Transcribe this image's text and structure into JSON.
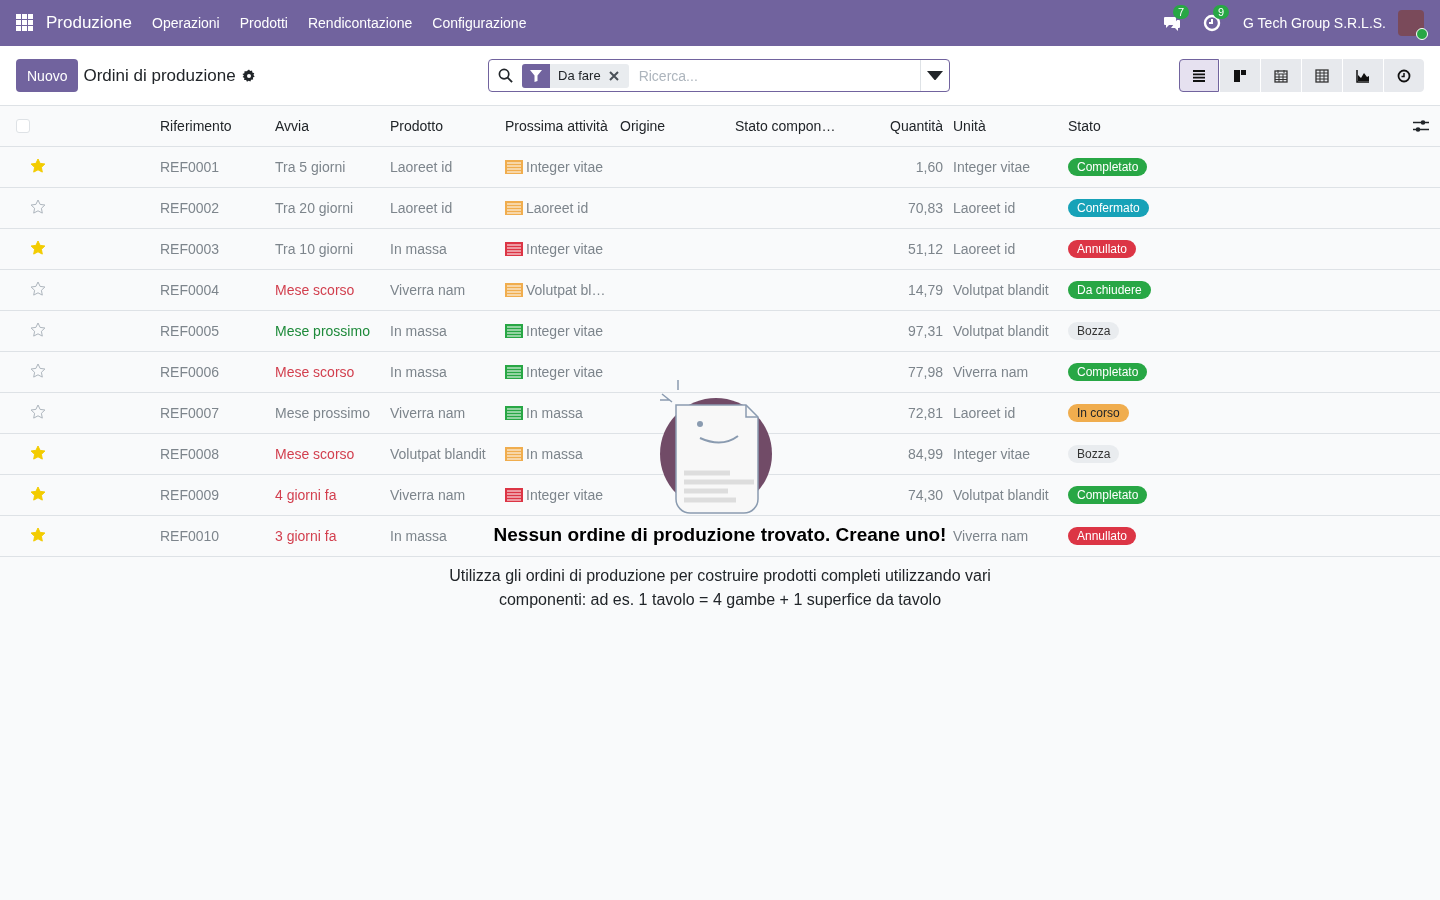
{
  "navbar": {
    "app_name": "Produzione",
    "menu": [
      "Operazioni",
      "Prodotti",
      "Rendicontazione",
      "Configurazione"
    ],
    "messages_count": "7",
    "activities_count": "9",
    "company": "G Tech Group S.R.L.S."
  },
  "control_panel": {
    "new_button": "Nuovo",
    "title": "Ordini di produzione",
    "search": {
      "facet": "Da fare",
      "placeholder": "Ricerca..."
    },
    "views": [
      {
        "kind": "list",
        "selected": true
      },
      {
        "kind": "kanban",
        "selected": false
      },
      {
        "kind": "calendar",
        "selected": false
      },
      {
        "kind": "pivot",
        "selected": false
      },
      {
        "kind": "graph",
        "selected": false
      },
      {
        "kind": "activity",
        "selected": false
      }
    ]
  },
  "table": {
    "select_all_checked": false,
    "columns": [
      "Riferimento",
      "Avvia",
      "Prodotto",
      "Prossima attività",
      "Origine",
      "Stato compon…",
      "Quantità",
      "Unità",
      "Stato"
    ],
    "rows": [
      {
        "starred": true,
        "reference": "REF0001",
        "start": {
          "label": "Tra 5 giorni",
          "color": "#7d858c"
        },
        "product": "Laoreet id",
        "activity": {
          "label": "Integer vitae",
          "color": "#f0ad4e"
        },
        "quantity": "1,60",
        "unit": "Integer vitae",
        "status": {
          "label": "Completato",
          "color": "#28a745"
        }
      },
      {
        "starred": false,
        "reference": "REF0002",
        "start": {
          "label": "Tra 20 giorni",
          "color": "#7d858c"
        },
        "product": "Laoreet id",
        "activity": {
          "label": "Laoreet id",
          "color": "#f0ad4e"
        },
        "quantity": "70,83",
        "unit": "Laoreet id",
        "status": {
          "label": "Confermato",
          "color": "#17a2b8"
        }
      },
      {
        "starred": true,
        "reference": "REF0003",
        "start": {
          "label": "Tra 10 giorni",
          "color": "#7d858c"
        },
        "product": "In massa",
        "activity": {
          "label": "Integer vitae",
          "color": "#dc3545"
        },
        "quantity": "51,12",
        "unit": "Laoreet id",
        "status": {
          "label": "Annullato",
          "color": "#dc3545"
        }
      },
      {
        "starred": false,
        "reference": "REF0004",
        "start": {
          "label": "Mese scorso",
          "color": "#d23f4e"
        },
        "product": "Viverra nam",
        "activity": {
          "label": "Volutpat bl…",
          "color": "#f0ad4e"
        },
        "quantity": "14,79",
        "unit": "Volutpat blandit",
        "status": {
          "label": "Da chiudere",
          "color": "#28a745"
        }
      },
      {
        "starred": false,
        "reference": "REF0005",
        "start": {
          "label": "Mese prossimo",
          "color": "#1e8a3a"
        },
        "product": "In massa",
        "activity": {
          "label": "Integer vitae",
          "color": "#28a745"
        },
        "quantity": "97,31",
        "unit": "Volutpat blandit",
        "status": {
          "label": "Bozza",
          "color": "#e9ecef"
        }
      },
      {
        "starred": false,
        "reference": "REF0006",
        "start": {
          "label": "Mese scorso",
          "color": "#d23f4e"
        },
        "product": "In massa",
        "activity": {
          "label": "Integer vitae",
          "color": "#28a745"
        },
        "quantity": "77,98",
        "unit": "Viverra nam",
        "status": {
          "label": "Completato",
          "color": "#28a745"
        }
      },
      {
        "starred": false,
        "reference": "REF0007",
        "start": {
          "label": "Mese prossimo",
          "color": "#7d858c"
        },
        "product": "Viverra nam",
        "activity": {
          "label": "In massa",
          "color": "#28a745"
        },
        "quantity": "72,81",
        "unit": "Laoreet id",
        "status": {
          "label": "In corso",
          "color": "#f0ad4e"
        }
      },
      {
        "starred": true,
        "reference": "REF0008",
        "start": {
          "label": "Mese scorso",
          "color": "#d23f4e"
        },
        "product": "Volutpat blandit",
        "activity": {
          "label": "In massa",
          "color": "#f0ad4e"
        },
        "quantity": "84,99",
        "unit": "Integer vitae",
        "status": {
          "label": "Bozza",
          "color": "#e9ecef"
        }
      },
      {
        "starred": true,
        "reference": "REF0009",
        "start": {
          "label": "4 giorni fa",
          "color": "#d23f4e"
        },
        "product": "Viverra nam",
        "activity": {
          "label": "Integer vitae",
          "color": "#dc3545"
        },
        "quantity": "74,30",
        "unit": "Volutpat blandit",
        "status": {
          "label": "Completato",
          "color": "#28a745"
        }
      },
      {
        "starred": true,
        "reference": "REF0010",
        "start": {
          "label": "3 giorni fa",
          "color": "#d23f4e"
        },
        "product": "In massa",
        "unit": "Viverra nam",
        "status": {
          "label": "Annullato",
          "color": "#dc3545"
        }
      }
    ]
  },
  "empty_state": {
    "title": "Nessun ordine di produzione trovato. Creane uno!",
    "text": "Utilizza gli ordini di produzione per costruire prodotti completi utilizzando vari componenti: ad es. 1 tavolo = 4 gambe + 1 superfice da tavolo"
  }
}
